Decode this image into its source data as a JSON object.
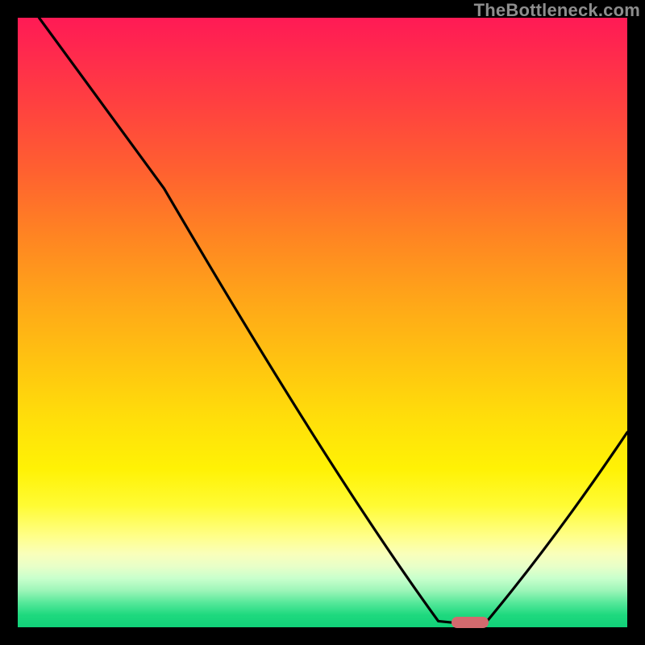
{
  "watermark": "TheBottleneck.com",
  "marker": {
    "x_frac": 0.742,
    "y_frac": 0.992,
    "color": "#d36a6e"
  },
  "chart_data": {
    "type": "line",
    "title": "",
    "xlabel": "",
    "ylabel": "",
    "xlim": [
      0,
      1
    ],
    "ylim": [
      0,
      1
    ],
    "axes_visible": false,
    "background": "heatmap-gradient-vertical",
    "gradient_stops": [
      {
        "pos": 0.0,
        "color": "#ff1a55"
      },
      {
        "pos": 0.25,
        "color": "#ff6030"
      },
      {
        "pos": 0.5,
        "color": "#ffb414"
      },
      {
        "pos": 0.75,
        "color": "#fff205"
      },
      {
        "pos": 0.9,
        "color": "#e8ffc8"
      },
      {
        "pos": 1.0,
        "color": "#11d179"
      }
    ],
    "series": [
      {
        "name": "bottleneck-curve",
        "x": [
          0.035,
          0.24,
          0.69,
          0.74,
          0.77,
          1.0
        ],
        "y": [
          1.0,
          0.72,
          0.01,
          0.005,
          0.01,
          0.32
        ],
        "stroke": "#000000",
        "stroke_width": 3
      }
    ],
    "annotations": [
      {
        "type": "pill",
        "x": 0.742,
        "y": 0.008,
        "color": "#d36a6e",
        "label": ""
      }
    ]
  }
}
